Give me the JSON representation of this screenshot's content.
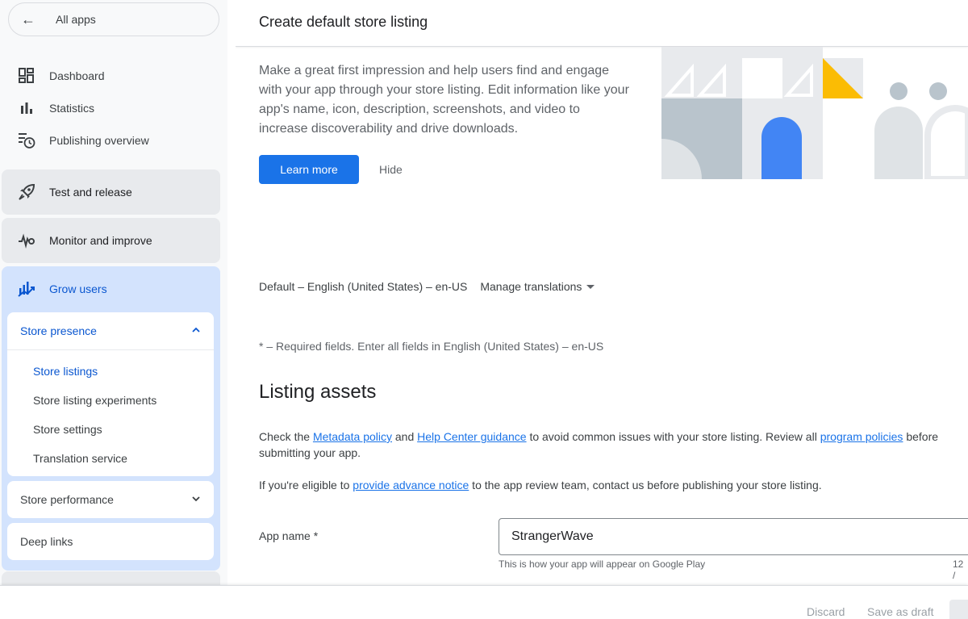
{
  "sidebar": {
    "all_apps_label": "All apps",
    "back_arrow": "←",
    "items": [
      {
        "label": "Dashboard",
        "icon": "dashboard-icon"
      },
      {
        "label": "Statistics",
        "icon": "bar-chart-icon"
      },
      {
        "label": "Publishing overview",
        "icon": "publishing-clock-icon"
      }
    ],
    "groups": [
      {
        "label": "Test and release",
        "icon": "rocket-icon"
      },
      {
        "label": "Monitor and improve",
        "icon": "vitals-icon"
      },
      {
        "label": "Grow users",
        "icon": "grow-chart-icon"
      }
    ],
    "store_presence": {
      "label": "Store presence",
      "sub_items": [
        "Store listings",
        "Store listing experiments",
        "Store settings",
        "Translation service"
      ]
    },
    "store_performance": {
      "label": "Store performance"
    },
    "deep_links": {
      "label": "Deep links"
    },
    "active_color": "#0b57d0"
  },
  "main": {
    "title": "Create default store listing",
    "promo_text": "Make a great first impression and help users find and engage with your app through your store listing. Edit information like your app's name, icon, description, screenshots, and video to increase discoverability and drive downloads.",
    "learn_more": "Learn more",
    "hide": "Hide",
    "language": "Default – English (United States) – en-US",
    "manage_translations": "Manage translations",
    "required_note": "* – Required fields. Enter all fields in English (United States) – en-US",
    "section_title": "Listing assets",
    "policy_para": {
      "t1": "Check the ",
      "link1": "Metadata policy",
      "t2": " and ",
      "link2": "Help Center guidance",
      "t3": " to avoid common issues with your store listing. Review all ",
      "link3": "program policies",
      "t4": " before submitting your app."
    },
    "notice_para": {
      "t1": "If you're eligible to ",
      "link1": "provide advance notice",
      "t2": " to the app review team, contact us before publishing your store listing."
    },
    "app_name_label": "App name  *",
    "app_name_value": "StrangerWave",
    "app_name_help": "This is how your app will appear on Google Play",
    "app_name_count": "12 /"
  },
  "footer": {
    "discard": "Discard",
    "save_draft": "Save as draft"
  },
  "colors": {
    "primary_button": "#1a73e8",
    "link": "#1a73e8",
    "illustration_yellow": "#fbbc04",
    "illustration_blue": "#4285f4"
  }
}
